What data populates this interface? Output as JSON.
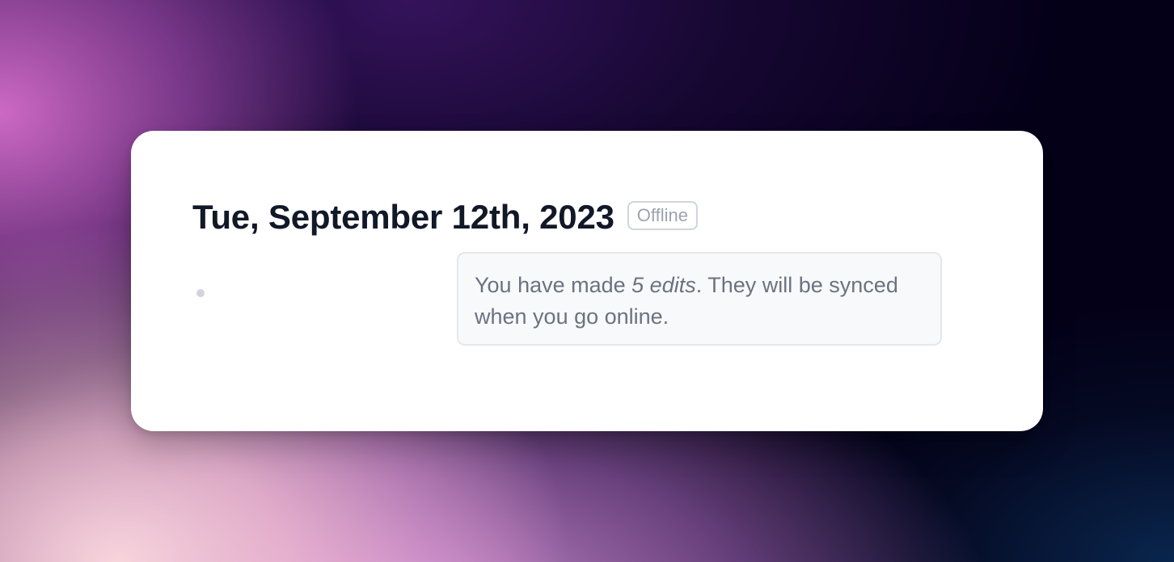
{
  "page": {
    "title": "Tue, September 12th, 2023",
    "status_badge": "Offline"
  },
  "notice": {
    "text_before": "You have made ",
    "edits_highlight": "5 edits",
    "text_after": ". They will be synced when you go online."
  },
  "colors": {
    "title": "#111827",
    "badge_text": "#9ca3af",
    "badge_border": "#d1d5db",
    "notice_bg": "#f8f9fb",
    "notice_border": "#e5e7eb",
    "notice_text": "#6b7280",
    "bullet": "#d1d5db"
  },
  "icons": {
    "bullet": "bullet-dot-icon"
  }
}
